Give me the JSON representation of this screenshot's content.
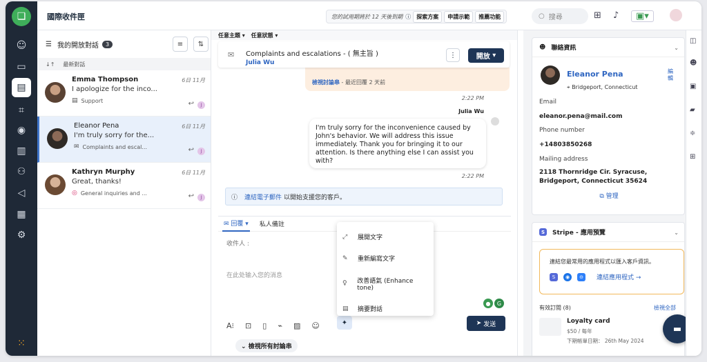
{
  "header": {
    "title": "國際收件匣",
    "trial_text": "您的試用期將於 12 天後到期",
    "explore": "探索方案",
    "demo": "申請示範",
    "recommend": "推薦功能",
    "search_placeholder": "搜尋"
  },
  "list": {
    "title": "我的開放對話",
    "count": "3",
    "sort_label": "最新對話",
    "items": [
      {
        "name": "Emma Thompson",
        "date": "6日 11月",
        "preview": "I apologize for the inco...",
        "inbox": "Support"
      },
      {
        "name": "Eleanor Pena",
        "date": "6日 11月",
        "preview": "I'm truly sorry for the...",
        "inbox": "Complaints and escal..."
      },
      {
        "name": "Kathryn Murphy",
        "date": "6日 11月",
        "preview": "Great, thanks!",
        "inbox": "General inquiries and ..."
      }
    ]
  },
  "conversation": {
    "filter_topic": "任意主題",
    "filter_status": "任意狀態",
    "title": "Complaints and escalations - ( 無主旨 )",
    "user": "Julia Wu",
    "status_button": "開放",
    "notice_link": "檢視討論串",
    "notice_text": "- 最近回覆 2 天前",
    "time1": "2:22 PM",
    "sender": "Julia Wu",
    "message": "I'm truly sorry for the inconvenience caused by John's behavior. We will address this issue immediately. Thank you for bringing it to our attention. Is there anything else I can assist you with?",
    "time2": "2:22 PM",
    "connect_link": "連結電子郵件",
    "connect_text": "以開始支援您的客戶。"
  },
  "composer": {
    "tab_reply": "回覆",
    "tab_note": "私人備註",
    "to_label": "收件人",
    "placeholder": "在此处输入您的消息",
    "send": "发送",
    "view_threads": "檢視所有討論串"
  },
  "ai_menu": [
    "展開文字",
    "重新編寫文字",
    "改善語氣 (Enhance tone)",
    "摘要對話"
  ],
  "contact": {
    "section": "聯絡資訊",
    "name": "Eleanor Pena",
    "edit": "編輯",
    "location": "Bridgeport, Connecticut",
    "email_label": "Email",
    "email": "eleanor.pena@mail.com",
    "phone_label": "Phone number",
    "phone": "+14803850268",
    "address_label": "Mailing address",
    "address": "2118 Thornridge Cir. Syracuse, Bridgeport, Connecticut 35624",
    "manage": "管理"
  },
  "stripe": {
    "title": "Stripe - 應用預覽",
    "connect_text": "連結您最常用的應用程式以匯入客戶資訊。",
    "connect_link": "連結應用程式 →",
    "subs_label": "有效訂閱 (8)",
    "view_all": "檢視全部",
    "plan_name": "Loyalty card",
    "plan_price": "$50 / 每年",
    "plan_date": "下期帳單日期： 26th May 2024"
  },
  "colors": {
    "accent": "#2f66c1",
    "dark": "#1e3556",
    "rail": "#1f2937"
  }
}
